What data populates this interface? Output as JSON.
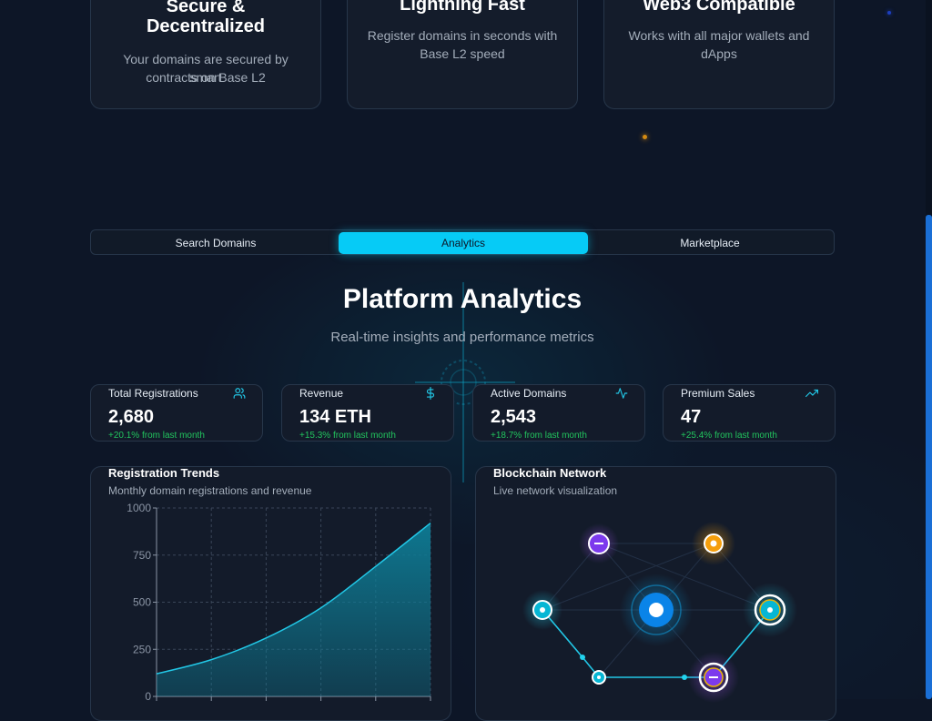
{
  "features": [
    {
      "title_line1": "Secure &",
      "title_line2": "Decentralized",
      "desc_line1": "Your domains are secured by smart",
      "desc_line2": "contracts on Base L2",
      "icon": "shield-icon"
    },
    {
      "title_line1": "Lightning Fast",
      "desc_line1": "Register domains in seconds with",
      "desc_line2": "Base L2 speed",
      "icon": "bolt-icon"
    },
    {
      "title_line1": "Web3 Compatible",
      "desc_line1": "Works with all major wallets and",
      "desc_line2": "dApps",
      "icon": "globe-icon"
    }
  ],
  "tabs": [
    {
      "label": "Search Domains",
      "active": false
    },
    {
      "label": "Analytics",
      "active": true
    },
    {
      "label": "Marketplace",
      "active": false
    }
  ],
  "analytics": {
    "title": "Platform Analytics",
    "subtitle": "Real-time insights and performance metrics"
  },
  "stats": [
    {
      "label": "Total Registrations",
      "value": "2,680",
      "change": "+20.1% from last month",
      "icon": "users-icon"
    },
    {
      "label": "Revenue",
      "value": "134 ETH",
      "change": "+15.3% from last month",
      "icon": "dollar-icon"
    },
    {
      "label": "Active Domains",
      "value": "2,543",
      "change": "+18.7% from last month",
      "icon": "activity-icon"
    },
    {
      "label": "Premium Sales",
      "value": "47",
      "change": "+25.4% from last month",
      "icon": "trending-up-icon"
    }
  ],
  "trends_panel": {
    "title": "Registration Trends",
    "subtitle": "Monthly domain registrations and revenue"
  },
  "network_panel": {
    "title": "Blockchain Network",
    "subtitle": "Live network visualization"
  },
  "chart_data": {
    "type": "area",
    "y_ticks": [
      "1000",
      "750",
      "500",
      "250",
      "0"
    ],
    "ylim": [
      0,
      1000
    ],
    "values": [
      120,
      195,
      310,
      470,
      690,
      920
    ],
    "grid": true,
    "fill_color": "#0e7c95",
    "line_color": "#22c7e6"
  },
  "colors": {
    "accent": "#06cbf6",
    "positive": "#22c55e",
    "background": "#0d1627"
  }
}
